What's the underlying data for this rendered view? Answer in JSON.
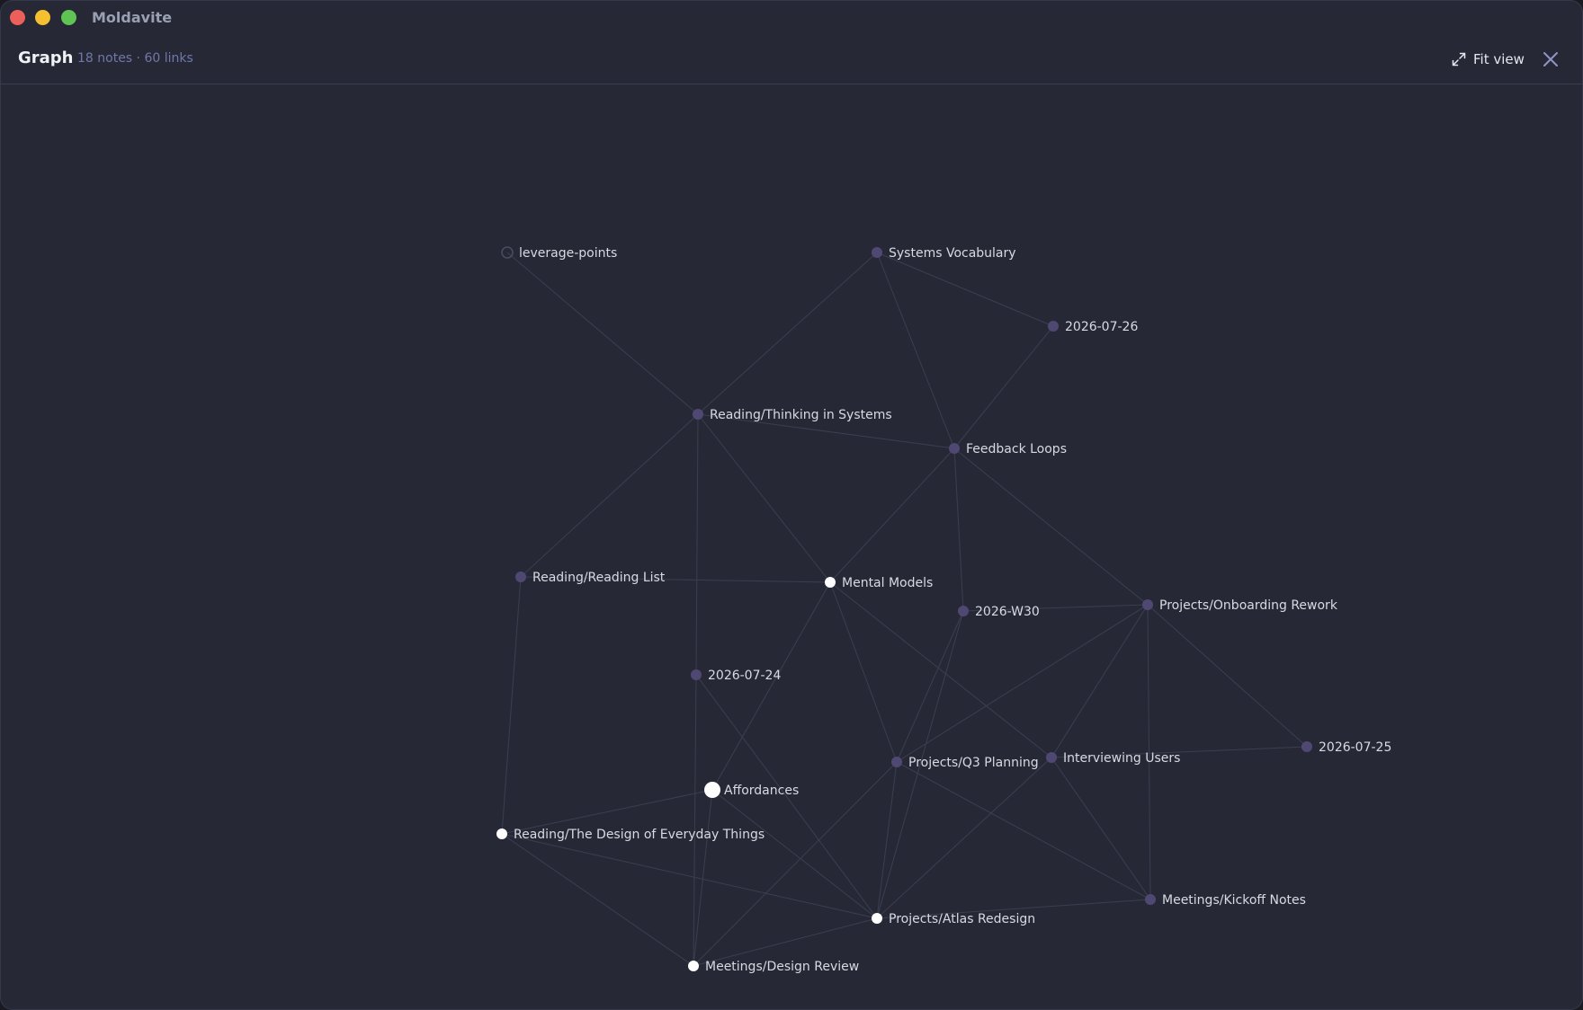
{
  "window": {
    "title": "Moldavite"
  },
  "header": {
    "title": "Graph",
    "stats": "18 notes · 60 links",
    "fit_view_label": "Fit view"
  },
  "icons": {
    "fit_view": "expand-arrows-icon",
    "close": "close-icon"
  },
  "colors": {
    "background": "#262935",
    "node_default": "#4f4873",
    "node_active": "#ffffff",
    "edge_default": "#3b3e52",
    "edge_highlight": "#7b83b8",
    "stats_text": "#6f78aa"
  },
  "graph": {
    "selected": "Affordances",
    "nodes": [
      {
        "id": "leverage-points",
        "label": "leverage-points",
        "state": "unresolved"
      },
      {
        "id": "systems-vocabulary",
        "label": "Systems Vocabulary",
        "state": "default"
      },
      {
        "id": "2026-07-26",
        "label": "2026-07-26",
        "state": "default"
      },
      {
        "id": "thinking-in-systems",
        "label": "Reading/Thinking in Systems",
        "state": "default"
      },
      {
        "id": "feedback-loops",
        "label": "Feedback Loops",
        "state": "default"
      },
      {
        "id": "reading-list",
        "label": "Reading/Reading List",
        "state": "default"
      },
      {
        "id": "mental-models",
        "label": "Mental Models",
        "state": "linked"
      },
      {
        "id": "2026-w30",
        "label": "2026-W30",
        "state": "default"
      },
      {
        "id": "onboarding-rework",
        "label": "Projects/Onboarding Rework",
        "state": "default"
      },
      {
        "id": "2026-07-24",
        "label": "2026-07-24",
        "state": "default"
      },
      {
        "id": "q3-planning",
        "label": "Projects/Q3 Planning",
        "state": "default"
      },
      {
        "id": "interviewing-users",
        "label": "Interviewing Users",
        "state": "default"
      },
      {
        "id": "2026-07-25",
        "label": "2026-07-25",
        "state": "default"
      },
      {
        "id": "affordances",
        "label": "Affordances",
        "state": "selected"
      },
      {
        "id": "design-everyday-things",
        "label": "Reading/The Design of Everyday Things",
        "state": "linked"
      },
      {
        "id": "kickoff-notes",
        "label": "Meetings/Kickoff Notes",
        "state": "default"
      },
      {
        "id": "atlas-redesign",
        "label": "Projects/Atlas Redesign",
        "state": "linked"
      },
      {
        "id": "design-review",
        "label": "Meetings/Design Review",
        "state": "linked"
      }
    ],
    "edges": [
      [
        "leverage-points",
        "thinking-in-systems"
      ],
      [
        "systems-vocabulary",
        "thinking-in-systems"
      ],
      [
        "systems-vocabulary",
        "2026-07-26"
      ],
      [
        "systems-vocabulary",
        "feedback-loops"
      ],
      [
        "2026-07-26",
        "feedback-loops"
      ],
      [
        "thinking-in-systems",
        "feedback-loops"
      ],
      [
        "thinking-in-systems",
        "reading-list"
      ],
      [
        "thinking-in-systems",
        "mental-models"
      ],
      [
        "thinking-in-systems",
        "2026-07-24"
      ],
      [
        "feedback-loops",
        "mental-models"
      ],
      [
        "feedback-loops",
        "2026-w30"
      ],
      [
        "feedback-loops",
        "onboarding-rework"
      ],
      [
        "reading-list",
        "mental-models"
      ],
      [
        "reading-list",
        "design-everyday-things"
      ],
      [
        "mental-models",
        "q3-planning"
      ],
      [
        "mental-models",
        "interviewing-users"
      ],
      [
        "2026-w30",
        "onboarding-rework"
      ],
      [
        "2026-w30",
        "q3-planning"
      ],
      [
        "2026-w30",
        "atlas-redesign"
      ],
      [
        "onboarding-rework",
        "q3-planning"
      ],
      [
        "onboarding-rework",
        "interviewing-users"
      ],
      [
        "onboarding-rework",
        "2026-07-25"
      ],
      [
        "onboarding-rework",
        "kickoff-notes"
      ],
      [
        "2026-07-24",
        "atlas-redesign"
      ],
      [
        "2026-07-24",
        "design-review"
      ],
      [
        "q3-planning",
        "kickoff-notes"
      ],
      [
        "q3-planning",
        "atlas-redesign"
      ],
      [
        "q3-planning",
        "design-review"
      ],
      [
        "interviewing-users",
        "2026-07-25"
      ],
      [
        "interviewing-users",
        "kickoff-notes"
      ],
      [
        "interviewing-users",
        "atlas-redesign"
      ],
      [
        "design-everyday-things",
        "atlas-redesign"
      ],
      [
        "design-everyday-things",
        "design-review"
      ],
      [
        "atlas-redesign",
        "kickoff-notes"
      ],
      [
        "atlas-redesign",
        "design-review"
      ],
      [
        "affordances",
        "mental-models"
      ],
      [
        "affordances",
        "design-everyday-things"
      ],
      [
        "affordances",
        "atlas-redesign"
      ],
      [
        "affordances",
        "design-review"
      ]
    ]
  }
}
